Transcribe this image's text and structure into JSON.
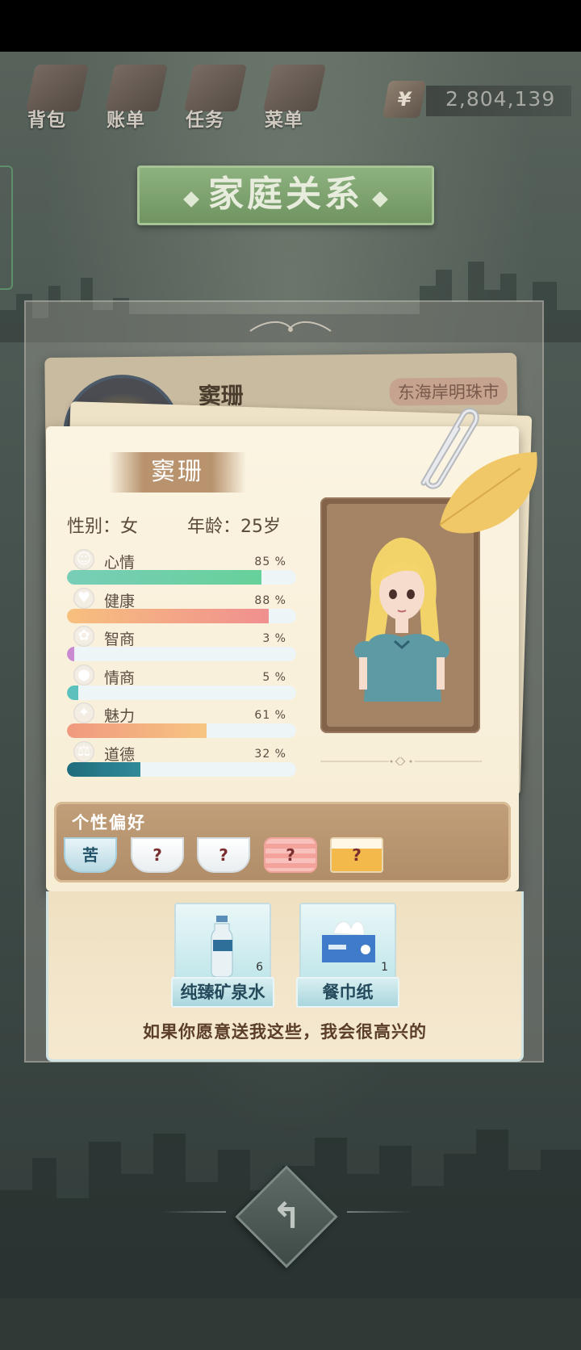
{
  "top_nav": {
    "items": [
      {
        "label": "背包",
        "icon": "bag-icon"
      },
      {
        "label": "账单",
        "icon": "bill-icon"
      },
      {
        "label": "任务",
        "icon": "task-icon"
      },
      {
        "label": "菜单",
        "icon": "menu-icon"
      }
    ],
    "money": {
      "currency_symbol": "¥",
      "value": "2,804,139"
    }
  },
  "title": "家庭关系",
  "background_card": {
    "name": "窦珊",
    "location": "东海岸明珠市"
  },
  "character": {
    "name": "窦珊",
    "gender_label": "性别：女",
    "age_label": "年龄：25岁",
    "stats": [
      {
        "label": "心情",
        "percent": "85 %",
        "value": 85,
        "icon": "smile-icon",
        "color_from": "#78cdb7",
        "color_to": "#66d19a"
      },
      {
        "label": "健康",
        "percent": "88 %",
        "value": 88,
        "icon": "heart-icon",
        "color_from": "#f7c07e",
        "color_to": "#f08f8f"
      },
      {
        "label": "智商",
        "percent": "3 %",
        "value": 3,
        "icon": "brain-icon",
        "color_from": "#c98ad2",
        "color_to": "#c98ad2"
      },
      {
        "label": "情商",
        "percent": "5 %",
        "value": 5,
        "icon": "apple-icon",
        "color_from": "#5cc0bc",
        "color_to": "#5cc0bc"
      },
      {
        "label": "魅力",
        "percent": "61 %",
        "value": 61,
        "icon": "sparkle-icon",
        "color_from": "#f0997e",
        "color_to": "#f7c582"
      },
      {
        "label": "道德",
        "percent": "32 %",
        "value": 32,
        "icon": "scales-icon",
        "color_from": "#1f6c7c",
        "color_to": "#2f8a98"
      }
    ]
  },
  "preferences": {
    "title": "个性偏好",
    "items": [
      {
        "text": "苦",
        "style": "bitter-cup"
      },
      {
        "text": "?",
        "style": "cup"
      },
      {
        "text": "?",
        "style": "cup"
      },
      {
        "text": "?",
        "style": "candy"
      },
      {
        "text": "?",
        "style": "beer"
      }
    ]
  },
  "gifts": {
    "items": [
      {
        "label": "纯臻矿泉水",
        "count": "6",
        "icon": "water-bottle-icon"
      },
      {
        "label": "餐巾纸",
        "count": "1",
        "icon": "tissue-box-icon"
      }
    ],
    "message": "如果你愿意送我这些，我会很高兴的"
  },
  "back_button": {
    "glyph": "↰"
  }
}
